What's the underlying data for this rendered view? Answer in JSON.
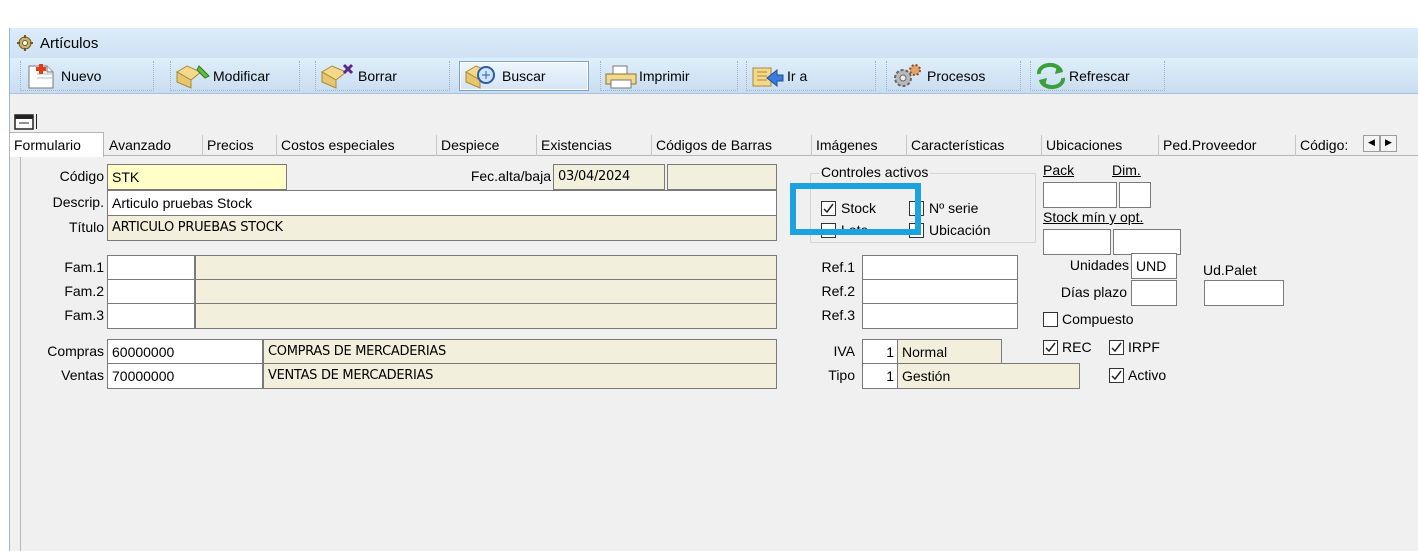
{
  "window": {
    "title": "Artículos"
  },
  "toolbar": {
    "buttons": [
      {
        "label": "Nuevo",
        "icon": "new-doc-icon"
      },
      {
        "label": "Modificar",
        "icon": "edit-icon"
      },
      {
        "label": "Borrar",
        "icon": "delete-icon"
      },
      {
        "label": "Buscar",
        "icon": "search-icon"
      },
      {
        "label": "Imprimir",
        "icon": "printer-icon"
      },
      {
        "label": "Ir a",
        "icon": "goto-icon"
      },
      {
        "label": "Procesos",
        "icon": "gears-icon"
      },
      {
        "label": "Refrescar",
        "icon": "refresh-icon"
      }
    ]
  },
  "tabs": [
    "Formulario",
    "Avanzado",
    "Precios",
    "Costos especiales",
    "Despiece",
    "Existencias",
    "Códigos de Barras",
    "Imágenes",
    "Características",
    "Ubicaciones",
    "Ped.Proveedor",
    "Código:"
  ],
  "form": {
    "codigo_label": "Código",
    "codigo_value": "STK",
    "fec_label": "Fec.alta/baja",
    "fec_alta": "03/04/2024",
    "fec_baja": "",
    "descrip_label": "Descrip.",
    "descrip_value": "Articulo pruebas Stock",
    "titulo_label": "Título",
    "titulo_value": "ARTICULO PRUEBAS STOCK",
    "fam1_label": "Fam.1",
    "fam2_label": "Fam.2",
    "fam3_label": "Fam.3",
    "compras_label": "Compras",
    "compras_code": "60000000",
    "compras_desc": "COMPRAS DE MERCADERIAS",
    "ventas_label": "Ventas",
    "ventas_code": "70000000",
    "ventas_desc": "VENTAS DE MERCADERIAS",
    "controles_title": "Controles activos",
    "stock_label": "Stock",
    "nserie_label": "Nº serie",
    "lote_label": "Lote",
    "ubicacion_label": "Ubicación",
    "ref1_label": "Ref.1",
    "ref2_label": "Ref.2",
    "ref3_label": "Ref.3",
    "iva_label": "IVA",
    "iva_num": "1",
    "iva_value": "Normal",
    "tipo_label": "Tipo",
    "tipo_num": "1",
    "tipo_value": "Gestión",
    "pack_label": "Pack",
    "dim_label": "Dim.",
    "stock_min_label": "Stock mín y opt.",
    "unidades_label": "Unidades",
    "unidades_value": "UND",
    "udpalet_label": "Ud.Palet",
    "dias_label": "Días plazo",
    "compuesto_label": "Compuesto",
    "rec_label": "REC",
    "irpf_label": "IRPF",
    "activo_label": "Activo"
  },
  "checks": {
    "stock": true,
    "nserie": false,
    "lote": false,
    "ubicacion": false,
    "compuesto": false,
    "rec": true,
    "irpf": true,
    "activo": true
  },
  "colors": {
    "highlight": "#1aa3e0",
    "beige_field": "#f2efdc",
    "yellow_field": "#ffffc7"
  }
}
